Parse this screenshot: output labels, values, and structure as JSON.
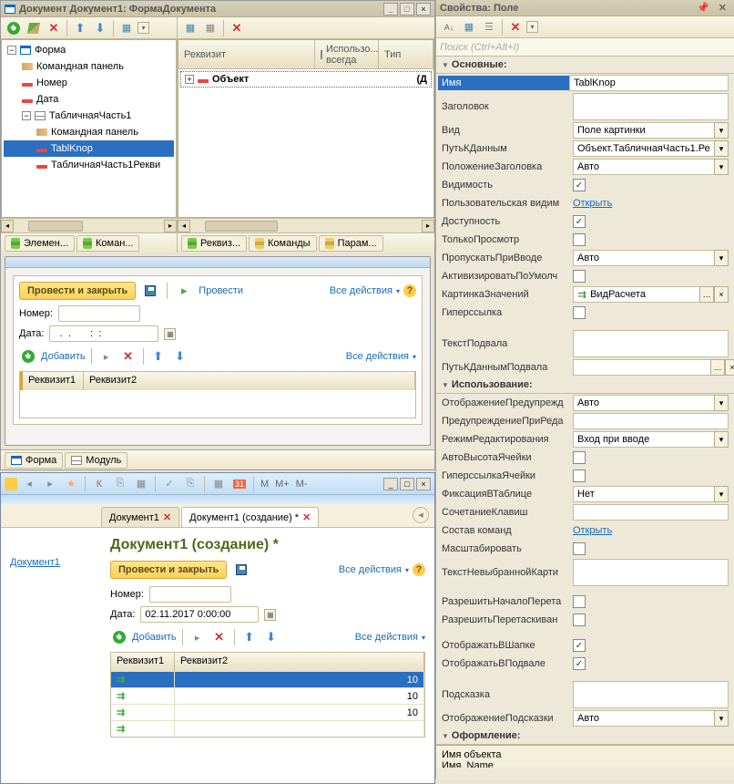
{
  "designer": {
    "title": "Документ Документ1: ФормаДокумента",
    "tree": {
      "root": "Форма",
      "n1": "Командная панель",
      "n2": "Номер",
      "n3": "Дата",
      "n4": "ТабличнаяЧасть1",
      "n5": "Командная панель",
      "n6": "TablKnop",
      "n7": "ТабличнаяЧасть1Рекви"
    },
    "rightGrid": {
      "col1": "Реквизит",
      "col2": "Использо... всегда",
      "col3": "Тип",
      "row1": "Объект",
      "row1v": "(Д"
    },
    "tabs": {
      "t1": "Элемен...",
      "t2": "Коман...",
      "t3": "Реквиз...",
      "t4": "Команды",
      "t5": "Парам..."
    },
    "bottomTabs": {
      "form": "Форма",
      "module": "Модуль"
    }
  },
  "preview": {
    "btn_post_close": "Провести и закрыть",
    "btn_post": "Провести",
    "btn_all": "Все действия",
    "lbl_number": "Номер:",
    "lbl_date": "Дата:",
    "date_value": "  .  .       :  :",
    "btn_add": "Добавить",
    "col1": "Реквизит1",
    "col2": "Реквизит2"
  },
  "runtime": {
    "nav": "Документ1",
    "tab1": "Документ1",
    "tab2": "Документ1 (создание) *",
    "title": "Документ1 (создание) *",
    "btn_post_close": "Провести и закрыть",
    "btn_all": "Все действия",
    "lbl_number": "Номер:",
    "lbl_date": "Дата:",
    "date_value": "02.11.2017 0:00:00",
    "btn_add": "Добавить",
    "col1": "Реквизит1",
    "col2": "Реквизит2",
    "cell_val": "10",
    "m": "M",
    "mplus": "M+",
    "mminus": "M-",
    "k": "К"
  },
  "props": {
    "title": "Свойства: Поле",
    "search_ph": "Поиск (Ctrl+Alt+I)",
    "sec_main": "Основные:",
    "sec_use": "Использование:",
    "sec_design": "Оформление:",
    "r": {
      "name_l": "Имя",
      "name_v": "TablKnop",
      "title_l": "Заголовок",
      "title_v": "",
      "kind_l": "Вид",
      "kind_v": "Поле картинки",
      "path_l": "ПутьКДанным",
      "path_v": "Объект.ТабличнаяЧасть1.Ре",
      "titlepos_l": "ПоложениеЗаголовка",
      "titlepos_v": "Авто",
      "vis_l": "Видимость",
      "uservis_l": "Пользовательская видим",
      "uservis_v": "Открыть",
      "avail_l": "Доступность",
      "readonly_l": "ТолькоПросмотр",
      "skip_l": "ПропускатьПриВводе",
      "skip_v": "Авто",
      "activdef_l": "АктивизироватьПоУмолч",
      "picvals_l": "КартинкаЗначений",
      "picvals_v": "ВидРасчета",
      "hyper_l": "Гиперссылка",
      "footer_l": "ТекстПодвала",
      "footer_v": "",
      "footerpath_l": "ПутьКДаннымПодвала",
      "footerpath_v": "",
      "warnview_l": "ОтображениеПредупрежд",
      "warnview_v": "Авто",
      "warnedit_l": "ПредупреждениеПриРеда",
      "warnedit_v": "",
      "editmode_l": "РежимРедактирования",
      "editmode_v": "Вход при вводе",
      "autoheight_l": "АвтоВысотаЯчейки",
      "cellhyper_l": "ГиперссылкаЯчейки",
      "fix_l": "ФиксацияВТаблице",
      "fix_v": "Нет",
      "keys_l": "СочетаниеКлавиш",
      "keys_v": "",
      "cmdset_l": "Состав команд",
      "cmdset_v": "Открыть",
      "scale_l": "Масштабировать",
      "noimg_l": "ТекстНевыбраннойКарти",
      "noimg_v": "",
      "dragbegin_l": "РазрешитьНачалоПерета",
      "drag_l": "РазрешитьПеретаскиван",
      "showhead_l": "ОтображатьВШапке",
      "showfoot_l": "ОтображатьВПодвале",
      "tip_l": "Подсказка",
      "tip_v": "",
      "tipview_l": "ОтображениеПодсказки",
      "tipview_v": "Авто"
    },
    "footer1": "Имя объекта",
    "footer2": "Имя. Name"
  }
}
